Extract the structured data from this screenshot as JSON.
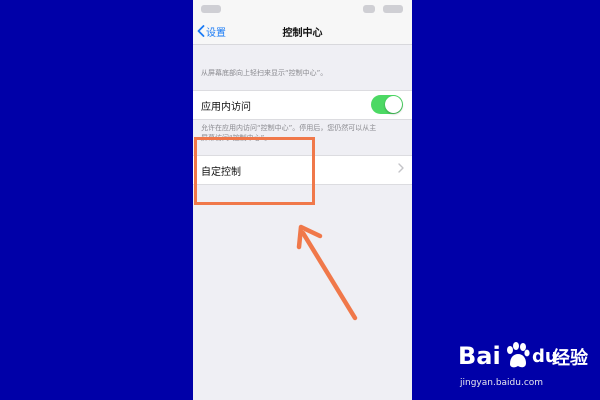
{
  "nav": {
    "back_label": "设置",
    "title": "控制中心"
  },
  "main": {
    "description": "从屏幕底部向上轻扫来显示“控制中心”。",
    "in_app_access": {
      "label": "应用内访问",
      "enabled": true
    },
    "in_app_footer": {
      "line1": "允许在应用内访问“控制中心”。停用后，您仍然可以从主",
      "line2": "屏幕访问“控制中心”。"
    },
    "customize": {
      "label": "自定控制"
    }
  },
  "annotation": {
    "highlight_color": "#f0784a"
  },
  "watermark": {
    "brand_bai": "Bai",
    "brand_du": "du",
    "brand_jingyan": "经验",
    "url": "jingyan.baidu.com"
  },
  "colors": {
    "background": "#0000a8",
    "ios_blue": "#1a7bf5",
    "toggle_green": "#4cd964"
  },
  "icons": {
    "back": "chevron-left-icon",
    "disclosure": "chevron-right-icon",
    "logo_paw": "paw-icon"
  }
}
